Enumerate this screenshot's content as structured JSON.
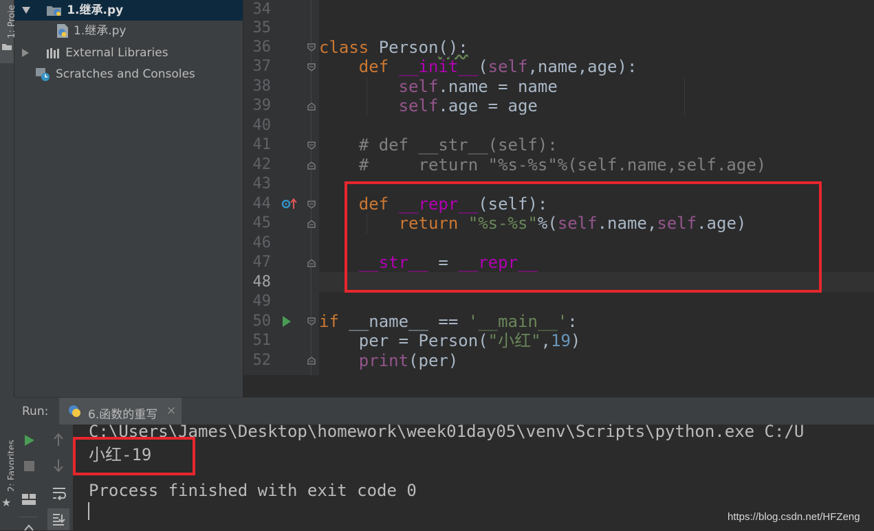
{
  "sidebar": {
    "project_tab_label": "1: Proje",
    "favorites_tab_label": "2: Favorites"
  },
  "project_tree": {
    "items": [
      {
        "label": "1.继承.py",
        "selected": true,
        "expanded": true
      },
      {
        "label": "1.继承.py"
      },
      {
        "label": "External Libraries",
        "collapsed": true
      },
      {
        "label": "Scratches and Consoles"
      }
    ]
  },
  "editor": {
    "lines": [
      {
        "num": "34"
      },
      {
        "num": "35"
      },
      {
        "num": "36"
      },
      {
        "num": "37"
      },
      {
        "num": "38"
      },
      {
        "num": "39"
      },
      {
        "num": "40"
      },
      {
        "num": "41"
      },
      {
        "num": "42"
      },
      {
        "num": "43"
      },
      {
        "num": "44"
      },
      {
        "num": "45"
      },
      {
        "num": "46"
      },
      {
        "num": "47"
      },
      {
        "num": "48"
      },
      {
        "num": "49"
      },
      {
        "num": "50"
      },
      {
        "num": "51"
      },
      {
        "num": "52"
      }
    ],
    "code": {
      "l36": {
        "kw": "class",
        "name": " Person",
        "rest": "():"
      },
      "l37": {
        "kw": "def",
        "sp": " ",
        "fn": "__init__",
        "p1": "(",
        "self": "self",
        "rest": ",name,age):"
      },
      "l38": {
        "self": "self",
        "rest": ".name = name"
      },
      "l39": {
        "self": "self",
        "rest": ".age = age"
      },
      "l41": "# def __str__(self):",
      "l42": "#     return \"%s-%s\"%(self.name,self.age)",
      "l44": {
        "kw": "def",
        "sp": " ",
        "fn": "__repr__",
        "rest": "(self):"
      },
      "l45": {
        "kw": "return",
        "sp": " ",
        "str": "\"%s-%s\"",
        "p1": "%(",
        "self1": "self",
        "m1": ".name,",
        "self2": "self",
        "m2": ".age)"
      },
      "l47": {
        "a": "__str__",
        "eq": " = ",
        "b": "__repr__"
      },
      "l50": {
        "kw": "if",
        "sp": " ",
        "v": "__name__",
        "eq": " == ",
        "str": "'__main__'",
        "end": ":"
      },
      "l51": {
        "a": "per = Person(",
        "str": "\"小红\"",
        "comma": ",",
        "num": "19",
        "end": ")"
      },
      "l52": {
        "fn": "print",
        "rest": "(per)"
      }
    }
  },
  "run_panel": {
    "label": "Run:",
    "tab_label": "6.函数的重写",
    "console": {
      "cmd": "C:\\Users\\James\\Desktop\\homework\\week01day05\\venv\\Scripts\\python.exe C:/U",
      "output": "小红-19",
      "exit": "Process finished with exit code 0"
    }
  },
  "watermark": "https://blog.csdn.net/HFZeng",
  "colors": {
    "keyword": "#cc7832",
    "self": "#94558d",
    "magic": "#b200b2",
    "string": "#6a8759",
    "number": "#6897bb",
    "highlight_box": "#e8262d"
  }
}
